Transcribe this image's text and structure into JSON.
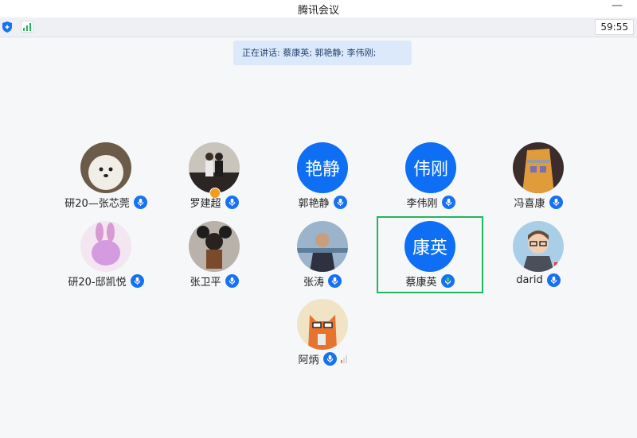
{
  "window": {
    "title": "腾讯会议",
    "minimize": "—"
  },
  "toolbar": {
    "timer": "59:55"
  },
  "speaking": {
    "text": "正在讲话: 蔡康英; 郭艳静; 李伟刚;"
  },
  "colors": {
    "accent": "#0e6ff4",
    "active_border": "#23b55f",
    "banner_bg": "#dce9fb"
  },
  "participants": [
    {
      "name": "研20—张芯莞",
      "avatar": "photo"
    },
    {
      "name": "罗建超",
      "avatar": "photo"
    },
    {
      "name": "郭艳静",
      "avatar": "text",
      "avatar_text": "艳静"
    },
    {
      "name": "李伟刚",
      "avatar": "text",
      "avatar_text": "伟刚"
    },
    {
      "name": "冯喜康",
      "avatar": "photo"
    },
    {
      "name": "研20-邸凯悦",
      "avatar": "photo"
    },
    {
      "name": "张卫平",
      "avatar": "photo"
    },
    {
      "name": "张涛",
      "avatar": "photo"
    },
    {
      "name": "蔡康英",
      "avatar": "text",
      "avatar_text": "康英",
      "active": true
    },
    {
      "name": "darid",
      "avatar": "photo"
    },
    {
      "name": "阿炳",
      "avatar": "photo"
    }
  ]
}
